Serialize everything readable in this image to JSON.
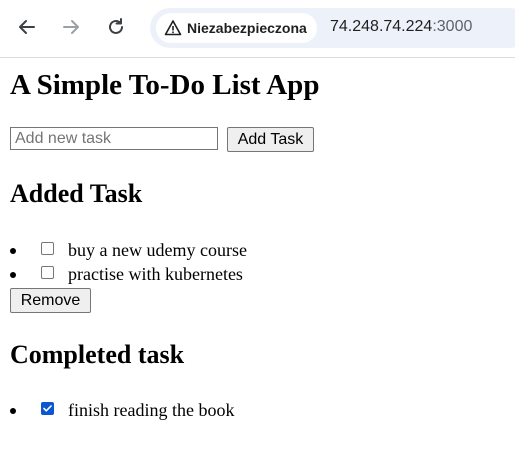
{
  "browser": {
    "security_label": "Niezabezpieczona",
    "url_host": "74.248.74.224",
    "url_port": ":3000"
  },
  "page": {
    "title": "A Simple To-Do List App",
    "input_placeholder": "Add new task",
    "input_value": "",
    "add_button": "Add Task",
    "added_heading": "Added Task",
    "added_tasks": [
      {
        "text": "buy a new udemy course",
        "checked": false
      },
      {
        "text": "practise with kubernetes",
        "checked": false
      }
    ],
    "remove_button": "Remove",
    "completed_heading": "Completed task",
    "completed_tasks": [
      {
        "text": "finish reading the book",
        "checked": true
      }
    ]
  },
  "colors": {
    "checkbox_checked": "#0b57d0",
    "omnibox_bg": "#edf2fa"
  }
}
